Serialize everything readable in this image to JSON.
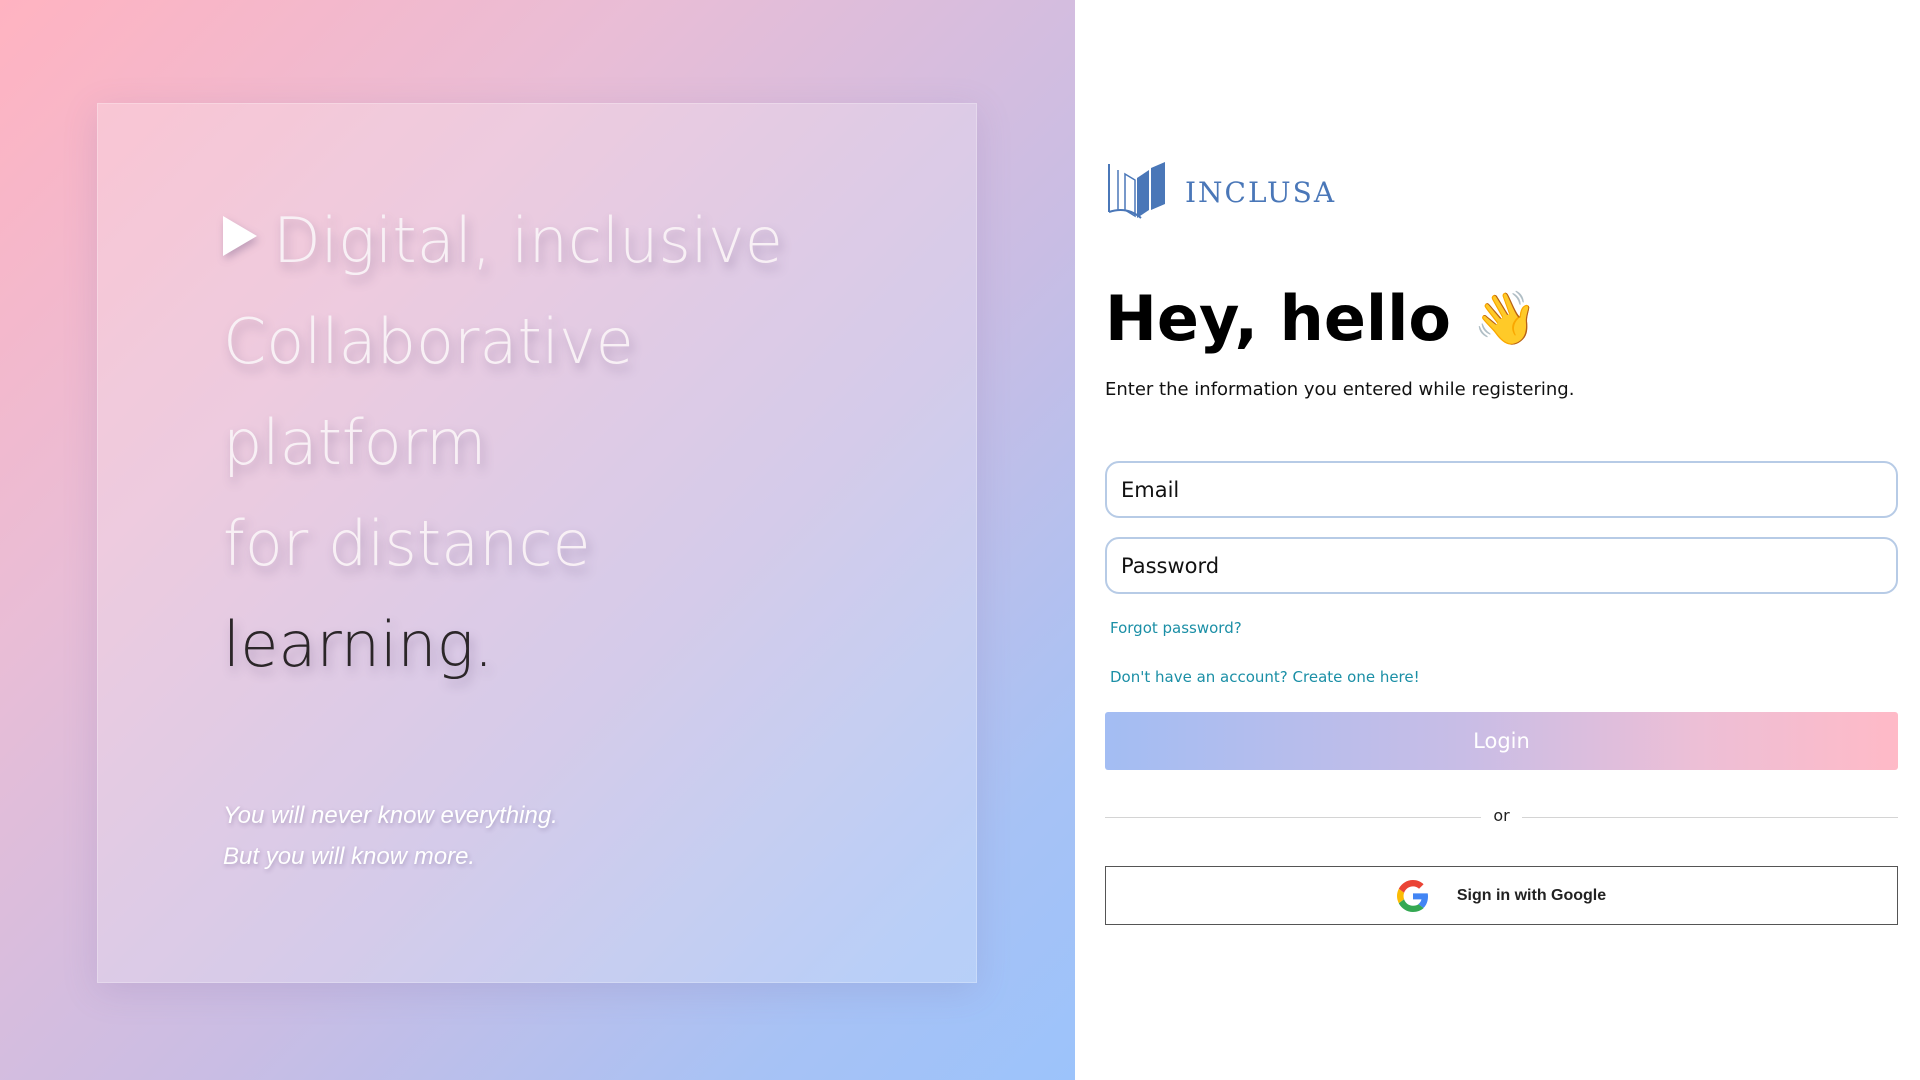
{
  "hero": {
    "lines": [
      "Digital, inclusive",
      "Collaborative",
      "platform",
      "for distance",
      "learning."
    ],
    "quote": [
      "You will never know everything.",
      "But you will know more."
    ]
  },
  "brand": {
    "name": "INCLUSA",
    "color": "#4a77b8"
  },
  "login": {
    "title": "Hey, hello",
    "wave_emoji": "👋",
    "subtitle": "Enter the information you entered while registering.",
    "email_placeholder": "Email",
    "password_placeholder": "Password",
    "forgot_link": "Forgot password?",
    "create_link": "Don't have an account? Create one here!",
    "login_button": "Login",
    "divider_text": "or",
    "google_button": "Sign in with Google",
    "link_color": "#1b8fa6"
  }
}
